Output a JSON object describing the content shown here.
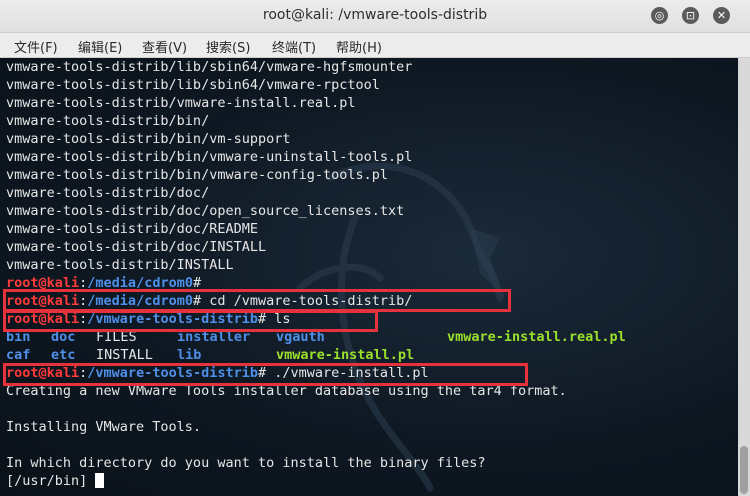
{
  "window": {
    "title": "root@kali: /vmware-tools-distrib",
    "minimize": "◎",
    "maximize": "⊡",
    "close": "✕"
  },
  "menu": [
    "文件(F)",
    "编辑(E)",
    "查看(V)",
    "搜索(S)",
    "终端(T)",
    "帮助(H)"
  ],
  "terminal": {
    "output_lines": [
      "vmware-tools-distrib/lib/sbin64/vmware-hgfsmounter",
      "vmware-tools-distrib/lib/sbin64/vmware-rpctool",
      "vmware-tools-distrib/vmware-install.real.pl",
      "vmware-tools-distrib/bin/",
      "vmware-tools-distrib/bin/vm-support",
      "vmware-tools-distrib/bin/vmware-uninstall-tools.pl",
      "vmware-tools-distrib/bin/vmware-config-tools.pl",
      "vmware-tools-distrib/doc/",
      "vmware-tools-distrib/doc/open_source_licenses.txt",
      "vmware-tools-distrib/doc/README",
      "vmware-tools-distrib/doc/INSTALL",
      "vmware-tools-distrib/INSTALL"
    ],
    "prompt_user": "root@kali",
    "prompts": [
      {
        "path": "/media/cdrom0",
        "cmd": ""
      },
      {
        "path": "/media/cdrom0",
        "cmd": " cd /vmware-tools-distrib/"
      },
      {
        "path": "/vmware-tools-distrib",
        "cmd": " ls"
      }
    ],
    "ls_rows": [
      [
        "bin",
        "doc",
        "FILES",
        "installer",
        "vgauth",
        "vmware-install.real.pl"
      ],
      [
        "caf",
        "etc",
        "INSTALL",
        "lib",
        "vmware-install.pl",
        ""
      ]
    ],
    "install_prompt": {
      "path": "/vmware-tools-distrib",
      "cmd": " ./vmware-install.pl"
    },
    "after_lines": [
      "Creating a new VMware Tools installer database using the tar4 format.",
      "",
      "Installing VMware Tools.",
      "",
      "In which directory do you want to install the binary files?",
      "[/usr/bin] "
    ]
  }
}
